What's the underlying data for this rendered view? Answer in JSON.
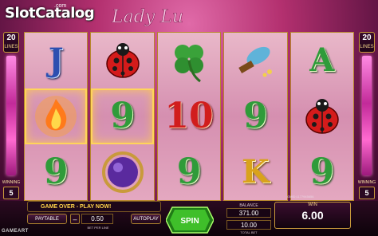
{
  "logo": {
    "main": "SlotCatalog",
    "suffix": ".com"
  },
  "title": "Lady Luck",
  "lines": {
    "left_value": "20",
    "right_value": "20",
    "label": "LINES"
  },
  "winning": {
    "label": "WINNING",
    "left_value": "5",
    "right_value": "5"
  },
  "reels": [
    [
      "J",
      "flame",
      "9"
    ],
    [
      "ladybug",
      "9",
      "crystal-ball"
    ],
    [
      "clover",
      "10",
      "9"
    ],
    [
      "feather",
      "9",
      "K"
    ],
    [
      "A",
      "ladybug",
      "9"
    ]
  ],
  "symbol_colors": {
    "J": "#2d4fb0",
    "9": "#2f9b3a",
    "10": "#d11d1d",
    "K": "#d9a21b",
    "A": "#2f9b3a"
  },
  "bottom": {
    "message": "GAME OVER - PLAY NOW!",
    "paytable": "PAYTABLE",
    "bet_value": "0.50",
    "bet_label": "BET PER LINE",
    "autoplay": "AUTOPLAY",
    "spin": "SPIN",
    "balance_label": "BALANCE",
    "balance": "371.00",
    "total_bet": "10.00",
    "total_bet_label": "TOTAL BET",
    "win_label": "WIN",
    "win": "6.00",
    "brand": "GAMEART",
    "game_id": "GMID:1177945656"
  }
}
